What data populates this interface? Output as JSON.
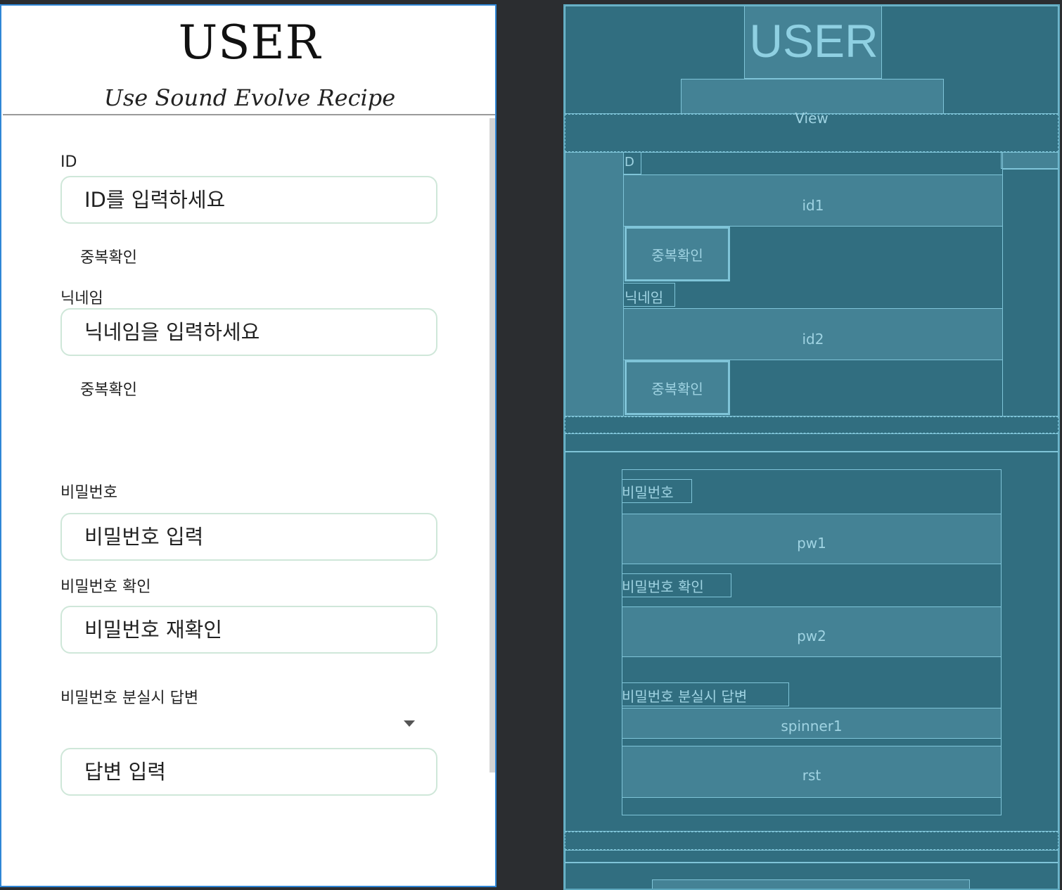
{
  "app": {
    "title": "USER",
    "subtitle": "Use Sound Evolve Recipe"
  },
  "form": {
    "id_label": "ID",
    "id_placeholder": "ID를 입력하세요",
    "id_check": "중복확인",
    "nick_label": "닉네임",
    "nick_placeholder": "닉네임을 입력하세요",
    "nick_check": "중복확인",
    "pw_label": "비밀번호",
    "pw_placeholder": "비밀번호 입력",
    "pw2_label": "비밀번호 확인",
    "pw2_placeholder": "비밀번호 재확인",
    "answer_label": "비밀번호 분실시 답변",
    "answer_placeholder": "답변 입력"
  },
  "blueprint": {
    "title": "USER",
    "view": "View",
    "id_label": "D",
    "id1": "id1",
    "check1": "중복확인",
    "nick_label": "닉네임",
    "id2": "id2",
    "check2": "중복확인",
    "pw_label": "비밀번호",
    "pw1": "pw1",
    "pw2_label": "비밀번호 확인",
    "pw2": "pw2",
    "answer_label": "비밀번호 분실시 답변",
    "spinner1": "spinner1",
    "rst": "rst"
  },
  "colors": {
    "selection_border": "#2f86d6",
    "field_border": "#cfe7d9",
    "blueprint_bg": "#316e80",
    "blueprint_line": "#7fc4d8"
  },
  "icons": {
    "spinner_arrow": "dropdown-arrow-icon"
  }
}
